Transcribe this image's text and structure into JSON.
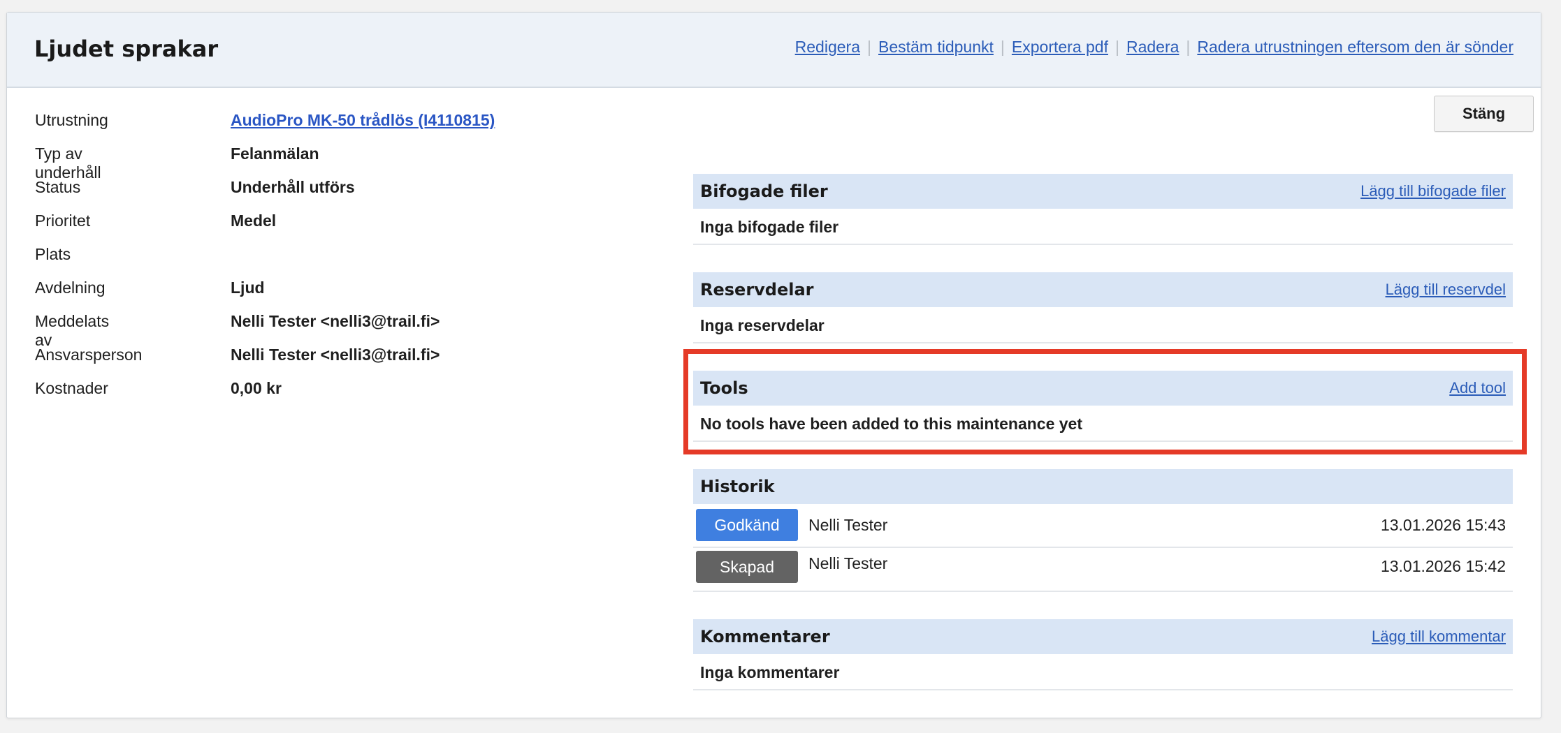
{
  "header": {
    "title": "Ljudet sprakar",
    "actions": {
      "edit": "Redigera",
      "schedule": "Bestäm tidpunkt",
      "export": "Exportera pdf",
      "delete": "Radera",
      "delete_broken": "Radera utrustningen eftersom den är sönder"
    }
  },
  "info": {
    "equipment": {
      "label": "Utrustning",
      "value": "AudioPro MK-50 trådlös (I4110815)"
    },
    "type": {
      "label": "Typ av underhåll",
      "value": "Felanmälan"
    },
    "status": {
      "label": "Status",
      "value": "Underhåll utförs"
    },
    "priority": {
      "label": "Prioritet",
      "value": "Medel"
    },
    "location": {
      "label": "Plats",
      "value": ""
    },
    "department": {
      "label": "Avdelning",
      "value": "Ljud"
    },
    "reported_by": {
      "label": "Meddelats av",
      "value": "Nelli Tester <nelli3@trail.fi>"
    },
    "responsible": {
      "label": "Ansvarsperson",
      "value": "Nelli Tester <nelli3@trail.fi>"
    },
    "costs": {
      "label": "Kostnader",
      "value": "0,00 kr"
    }
  },
  "close_button": "Stäng",
  "attachments": {
    "title": "Bifogade filer",
    "link": "Lägg till bifogade filer",
    "empty": "Inga bifogade filer"
  },
  "spare_parts": {
    "title": "Reservdelar",
    "link": "Lägg till reservdel",
    "empty": "Inga reservdelar"
  },
  "tools": {
    "title": "Tools",
    "link": "Add tool",
    "empty": "No tools have been added to this maintenance yet"
  },
  "history": {
    "title": "Historik",
    "rows": [
      {
        "badge": "Godkänd",
        "badge_color": "#3f7fe0",
        "user": "Nelli Tester",
        "time": "13.01.2026 15:43"
      },
      {
        "badge": "Skapad",
        "badge_color": "#636363",
        "user": "Nelli Tester",
        "time": "13.01.2026 15:42"
      }
    ]
  },
  "comments": {
    "title": "Kommentarer",
    "link": "Lägg till kommentar",
    "empty": "Inga kommentarer"
  },
  "colors": {
    "link": "#2b5cb8",
    "section_header": "#d9e5f5",
    "highlight": "#e53a27"
  }
}
